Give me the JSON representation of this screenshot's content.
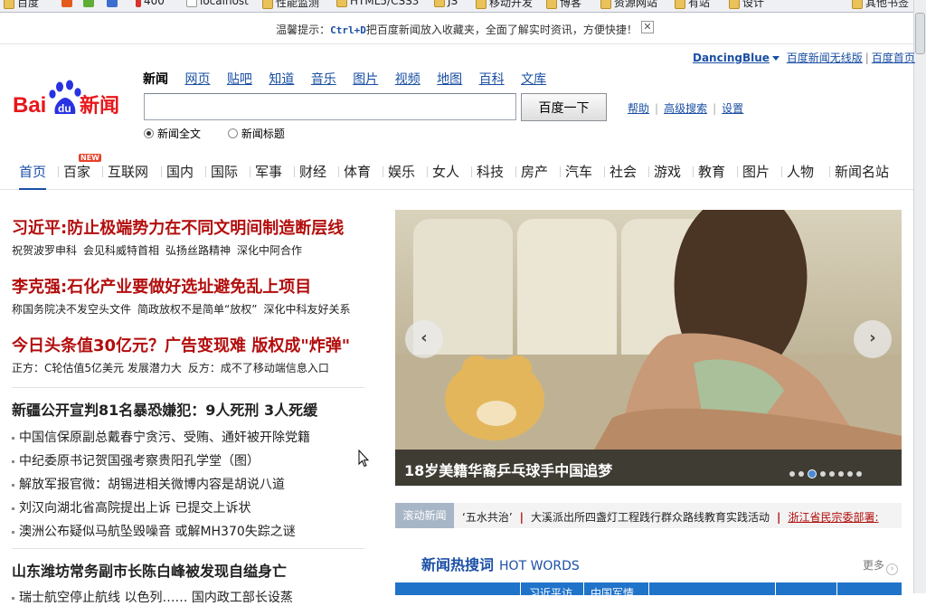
{
  "bookmarks": [
    "百度",
    "400",
    "localhost",
    "性能监测",
    "HTML5/CSS3",
    "JS",
    "移动开发",
    "博客",
    "资源网站",
    "有站",
    "设计",
    "其他书签"
  ],
  "tip": {
    "prefix": "温馨提示：",
    "key": "Ctrl+D",
    "suffix": "把百度新闻放入收藏夹，全面了解实时资讯，方便快捷！",
    "close": "✕"
  },
  "top_links": {
    "user": "DancingBlue",
    "wireless": "百度新闻无线版",
    "home": "百度首页"
  },
  "logo": {
    "text_bai": "Bai",
    "text_du": "du",
    "text_news": "新闻"
  },
  "search_tabs": [
    "新闻",
    "网页",
    "贴吧",
    "知道",
    "音乐",
    "图片",
    "视频",
    "地图",
    "百科",
    "文库"
  ],
  "search": {
    "value": "",
    "button": "百度一下"
  },
  "search_links": [
    "帮助",
    "高级搜索",
    "设置"
  ],
  "radio": {
    "full": "新闻全文",
    "title": "新闻标题"
  },
  "nav": [
    "首页",
    "百家",
    "互联网",
    "国内",
    "国际",
    "军事",
    "财经",
    "体育",
    "娱乐",
    "女人",
    "科技",
    "房产",
    "汽车",
    "社会",
    "游戏",
    "教育",
    "图片",
    "人物",
    "新闻名站"
  ],
  "nav_badge": "NEW",
  "news": {
    "h1": "习近平:防止极端势力在不同文明间制造断层线",
    "h1_sub": [
      "祝贺波罗申科",
      "会见科威特首相",
      "弘扬丝路精神",
      "深化中阿合作"
    ],
    "h2": "李克强:石化产业要做好选址避免乱上项目",
    "h2_sub": [
      "称国务院决不发空头文件",
      "简政放权不是简单“放权”",
      "深化中科友好关系"
    ],
    "h3": "今日头条值30亿元？广告变现难 版权成\"炸弹\"",
    "h3_sub": [
      "正方：C轮估值5亿美元 发展潜力大",
      "反方：成不了移动端信息入口"
    ],
    "h4": "新疆公开宣判81名暴恐嫌犯：9人死刑 3人死缓",
    "list1": [
      "中国信保原副总戴春宁贪污、受贿、通奸被开除党籍",
      "中纪委原书记贺国强考察贵阳孔学堂（图）",
      "解放军报官微：胡锡进相关微博内容是胡说八道",
      "刘汉向湖北省高院提出上诉 已提交上诉状",
      "澳洲公布疑似马航坠毁噪音 或解MH370失踪之谜"
    ],
    "h5": "山东潍坊常务副市长陈白峰被发现自缢身亡",
    "h5_partial": "瑞士航空停止航线 以色列…… 国内政工部长设蒸"
  },
  "carousel": {
    "caption": "18岁美籍华裔乒乓球手中国追梦",
    "prev": "‹",
    "next": "›",
    "dot_count": 8,
    "active_dot": 3
  },
  "scroll_news": {
    "label": "滚动新闻",
    "items": [
      "‘五水共治’",
      "大溪派出所四盏灯工程践行群众路线教育实践活动",
      "浙江省民宗委部署:"
    ]
  },
  "hot_words": {
    "title": "新闻热搜词",
    "subtitle": "HOT WORDS",
    "more": "更多",
    "tabs": [
      "习近平访",
      "中国军情"
    ]
  }
}
